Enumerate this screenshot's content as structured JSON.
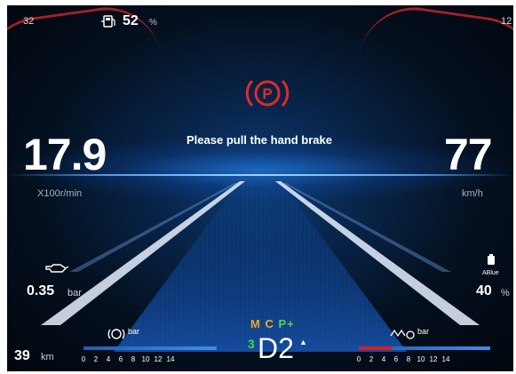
{
  "top": {
    "left_number": "32",
    "fuel_percent": "52",
    "fuel_unit": "%",
    "right_number": "12"
  },
  "alert": {
    "icon": "parking-brake-icon",
    "icon_color": "#e02a2a",
    "message": "Please pull the hand brake"
  },
  "rpm": {
    "value": "17.9",
    "unit": "X100r/min"
  },
  "speed": {
    "value": "77",
    "unit": "km/h"
  },
  "oil": {
    "icon": "oil-pressure-icon",
    "value": "0.35",
    "unit": "bar"
  },
  "adblue": {
    "icon": "adblue-icon",
    "icon_label": "ABlue",
    "value": "40",
    "unit": "%"
  },
  "odometer": {
    "value": "39",
    "unit": "km"
  },
  "air_left": {
    "icon": "air-brake-icon",
    "unit_label": "bar",
    "scale": [
      "0",
      "2",
      "4",
      "6",
      "8",
      "10",
      "12",
      "14"
    ]
  },
  "air_right": {
    "icon": "air-suspension-icon",
    "unit_label": "bar",
    "scale": [
      "0",
      "2",
      "4",
      "6",
      "8",
      "10",
      "12",
      "14"
    ]
  },
  "gear": {
    "mode_m": "M",
    "mode_c": "C",
    "mode_p": "P+",
    "main": "D2",
    "sub": "3",
    "colors": {
      "m": "#f2a61b",
      "c": "#f2a61b",
      "p": "#4fd84f"
    }
  }
}
